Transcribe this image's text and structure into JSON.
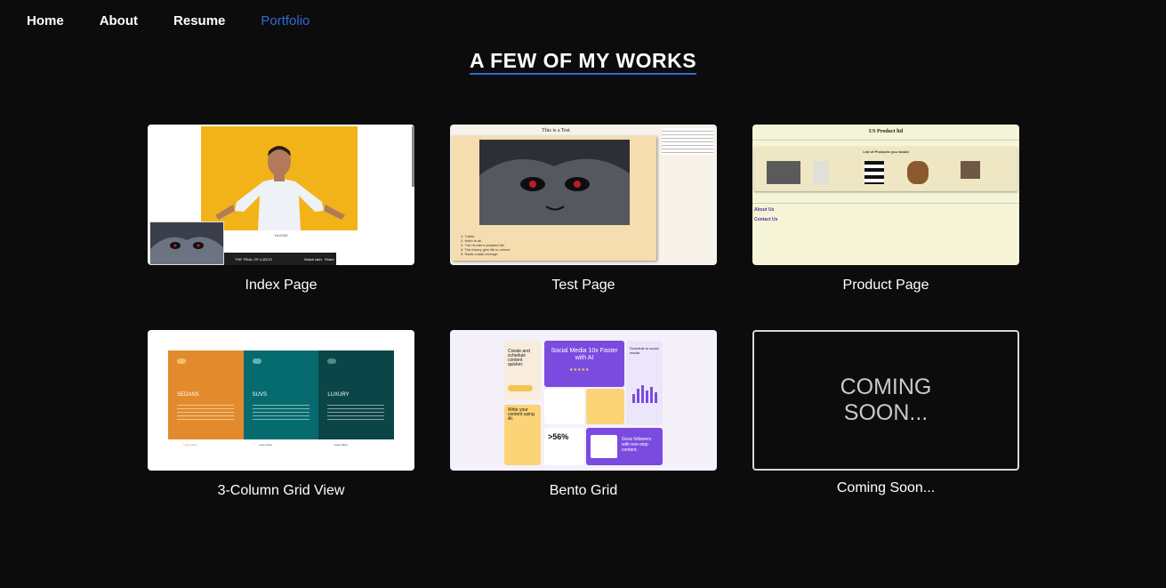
{
  "nav": {
    "items": [
      {
        "label": "Home"
      },
      {
        "label": "About"
      },
      {
        "label": "Resume"
      },
      {
        "label": "Portfolio",
        "active": true
      }
    ]
  },
  "heading": "A FEW OF MY WORKS",
  "works": [
    {
      "caption": "Index Page",
      "preview": {
        "name": "Ya KOKI",
        "video_title": "THE TRIAL OF LUDCO",
        "watch_later": "Watch later",
        "share": "Share"
      }
    },
    {
      "caption": "Test Page",
      "preview": {
        "title": "This is a Test",
        "list": [
          "1. Trailer",
          "2. Hello to all",
          "3. The Hunter's adopted list",
          "4. The theory give life to crimes",
          "5. Radio roads revenge"
        ]
      }
    },
    {
      "caption": "Product Page",
      "preview": {
        "title": "US Product ltd",
        "subtitle": "List of Products you would",
        "link_about": "About Us",
        "link_contact": "Contact Us"
      }
    },
    {
      "caption": "3-Column Grid View",
      "preview": {
        "columns": [
          {
            "title": "SEDANS"
          },
          {
            "title": "SUVS"
          },
          {
            "title": "LUXURY"
          }
        ],
        "button_label": "Learn More"
      }
    },
    {
      "caption": "Bento Grid",
      "preview": {
        "headline": "Social Media 10x Faster with AI",
        "create": "Create and schedule content quicker.",
        "write": "Write your content using AI.",
        "stat": ">56%",
        "followers": "Grow followers with non-stop content.",
        "schedule": "Schedule to social media."
      }
    },
    {
      "caption": "Coming Soon...",
      "placeholder": "COMING SOON..."
    }
  ],
  "colors": {
    "accent": "#2f6cd6",
    "background": "#0d0c0c"
  }
}
